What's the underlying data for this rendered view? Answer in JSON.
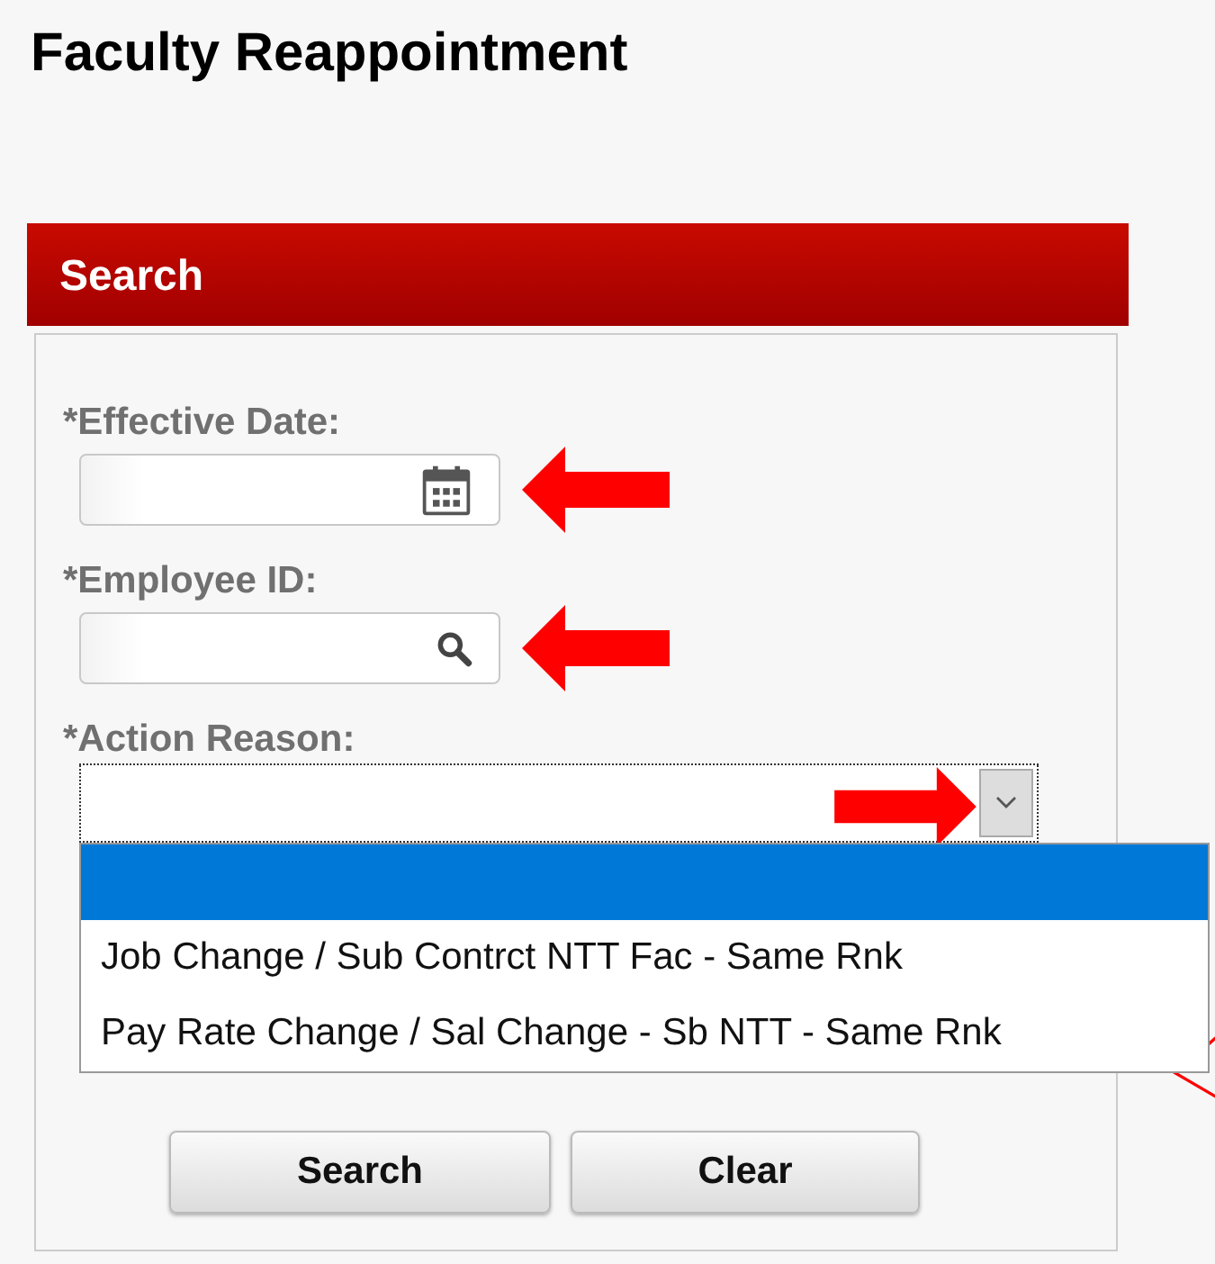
{
  "title": "Faculty Reappointment",
  "search_panel": {
    "header": "Search",
    "fields": [
      {
        "label": "*Effective Date:",
        "kind": "date",
        "arrow_annotation": true
      },
      {
        "label": "*Employee ID:",
        "kind": "lookup",
        "arrow_annotation": true
      },
      {
        "label": "*Action Reason:",
        "kind": "select",
        "arrow_annotation": true,
        "expanded": true,
        "options": [
          {
            "selected": true
          },
          {
            "label": "Job Change / Sub Contrct NTT Fac - Same Rnk",
            "selected": false
          },
          {
            "label": "Pay Rate Change / Sal Change - Sb NTT - Same Rnk",
            "selected": false
          }
        ]
      }
    ],
    "buttons": [
      "Search",
      "Clear"
    ]
  }
}
